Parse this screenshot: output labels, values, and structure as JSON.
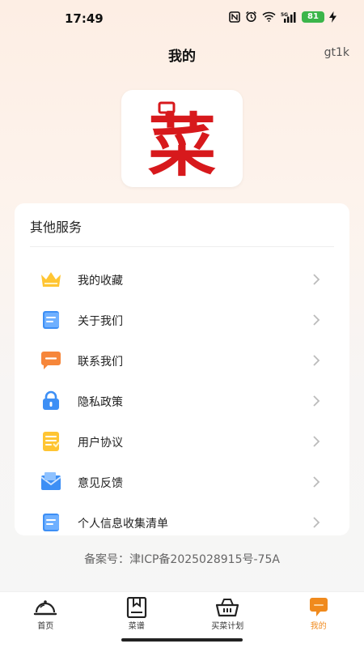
{
  "status_bar": {
    "time": "17:49",
    "battery": "81",
    "icons": [
      "nfc-icon",
      "alarm-icon",
      "wifi-icon",
      "5g-signal-icon",
      "battery-icon",
      "charging-icon"
    ]
  },
  "header": {
    "title": "我的",
    "user": "gt1k"
  },
  "logo": {
    "char": "菜",
    "color": "#d7191c"
  },
  "services": {
    "title": "其他服务",
    "items": [
      {
        "label": "我的收藏",
        "icon": "crown-icon"
      },
      {
        "label": "关于我们",
        "icon": "document-icon"
      },
      {
        "label": "联系我们",
        "icon": "chat-bubble-icon"
      },
      {
        "label": "隐私政策",
        "icon": "lock-icon"
      },
      {
        "label": "用户协议",
        "icon": "agreement-icon"
      },
      {
        "label": "意见反馈",
        "icon": "mail-icon"
      },
      {
        "label": "个人信息收集清单",
        "icon": "list-document-icon"
      }
    ]
  },
  "icp": "备案号：津ICP备2025028915号-75A",
  "tabbar": {
    "tabs": [
      {
        "label": "首页",
        "icon": "cloche-icon"
      },
      {
        "label": "菜谱",
        "icon": "recipe-book-icon"
      },
      {
        "label": "买菜计划",
        "icon": "basket-icon"
      },
      {
        "label": "我的",
        "icon": "profile-bubble-icon"
      }
    ],
    "active_color": "#f08a1d"
  }
}
